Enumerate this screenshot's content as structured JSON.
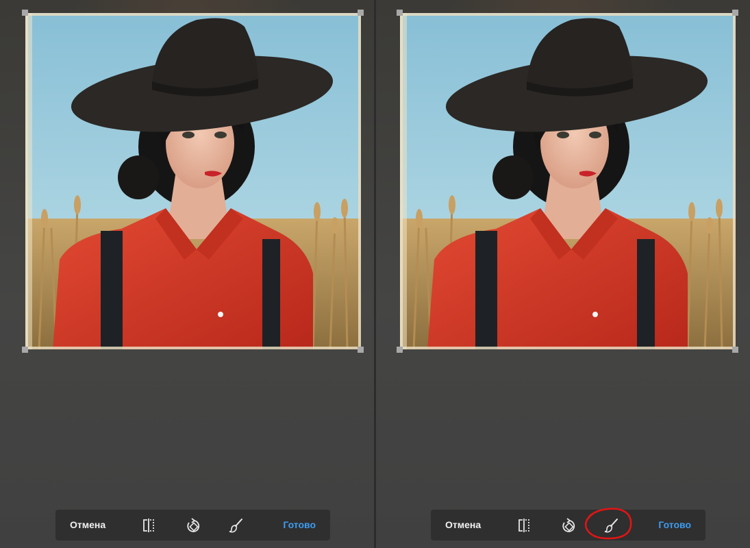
{
  "panels": [
    {
      "id": "before",
      "toolbar": {
        "cancel_label": "Отмена",
        "done_label": "Готово",
        "icons": [
          "flip-icon",
          "rotate-icon",
          "brush-icon"
        ]
      },
      "highlight": null
    },
    {
      "id": "after",
      "toolbar": {
        "cancel_label": "Отмена",
        "done_label": "Готово",
        "icons": [
          "flip-icon",
          "rotate-icon",
          "brush-icon"
        ]
      },
      "highlight": "brush-icon"
    }
  ],
  "photo": {
    "subject": "woman-in-black-hat-red-shirt"
  },
  "colors": {
    "toolbar_bg": "#2f2f2f",
    "cancel_text": "#f2f2f2",
    "done_text": "#3d9cf0",
    "annotation": "#e01515",
    "sky": "#9fcde0",
    "shirt": "#cf3222",
    "hat": "#2b2825"
  }
}
